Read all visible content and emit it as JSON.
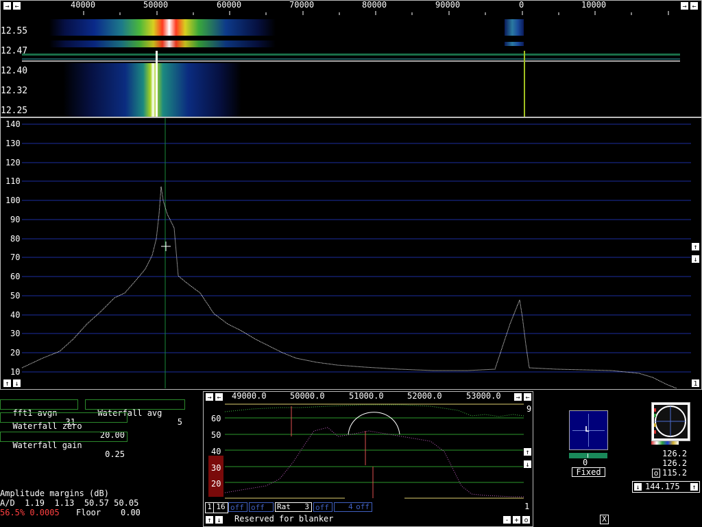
{
  "top_axis": {
    "ticks": [
      "40000",
      "50000",
      "60000",
      "70000",
      "80000",
      "90000",
      "0",
      "10000"
    ]
  },
  "waterfall": {
    "time_labels": [
      "12.55",
      "12.47",
      "12.40",
      "12.32",
      "12.25"
    ]
  },
  "spectrum": {
    "y_labels": [
      "140",
      "130",
      "120",
      "110",
      "100",
      "90",
      "80",
      "70",
      "60",
      "50",
      "40",
      "30",
      "20",
      "10"
    ]
  },
  "controls": {
    "fft1_avgn_label": "fft1 avgn",
    "fft1_avgn_value": "31",
    "waterfall_avg_label": "Waterfall avg",
    "waterfall_avg_value": "5",
    "waterfall_zero_label": "Waterfall zero",
    "waterfall_zero_value": "20.00",
    "waterfall_gain_label": "Waterfall gain",
    "waterfall_gain_value": "0.25"
  },
  "status": {
    "amp_margins": "Amplitude margins (dB)",
    "ad_line": "A/D  1.19  1.13  50.57 50.05",
    "red_line": "56.5% 0.0005",
    "floor_label": "Floor",
    "floor_value": "0.00"
  },
  "baseband": {
    "freq_ticks": [
      "49000.0",
      "50000.0",
      "51000.0",
      "52000.0",
      "53000.0"
    ],
    "y_labels": [
      "60",
      "50",
      "40",
      "30",
      "20"
    ],
    "right_top": "9",
    "right_bottom": "1",
    "btn_1": "1",
    "btn_16": "16",
    "off1": "off",
    "off2": "off",
    "rat_label": "Rat",
    "rat_value": "3",
    "off3": "off",
    "off4_value": "4",
    "off4": "off",
    "reserved": "Reserved for blanker",
    "minus": "-",
    "plus": "+",
    "o_btn": "o"
  },
  "meter": {
    "label_L": "L",
    "value": "0",
    "fixed": "Fixed"
  },
  "scope": {
    "v1": "126.2",
    "v2": "126.2",
    "o_label": "o",
    "v3": "115.2",
    "freq": "144.175"
  },
  "misc": {
    "close_x": "X",
    "spectrum_1": "1"
  }
}
